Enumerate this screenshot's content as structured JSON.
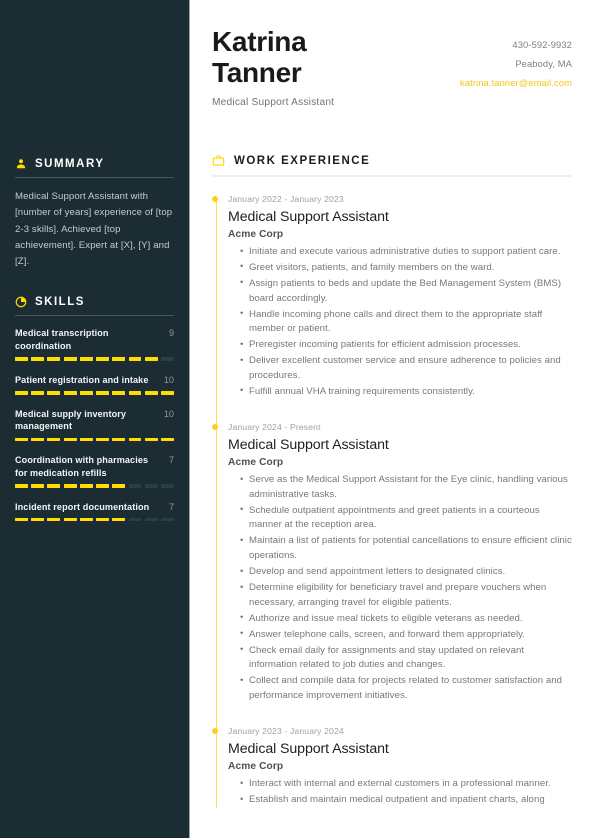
{
  "header": {
    "first_name": "Katrina",
    "last_name": "Tanner",
    "job_title": "Medical Support Assistant",
    "phone": "430-592-9932",
    "location": "Peabody, MA",
    "email": "katrina.tanner@email.com",
    "accent_color": "#ffdd00",
    "email_color": "#f5c518"
  },
  "sidebar": {
    "background_color": "#1b2d33",
    "summary": {
      "icon": "person-icon",
      "title": "SUMMARY",
      "text": "Medical Support Assistant with [number of years] experience of [top 2-3 skills]. Achieved [top achievement]. Expert at [X], [Y] and [Z]."
    },
    "skills": {
      "icon": "pie-chart-icon",
      "title": "SKILLS",
      "max_score": 10,
      "items": [
        {
          "name": "Medical transcription coordination",
          "score": 9
        },
        {
          "name": "Patient registration and intake",
          "score": 10
        },
        {
          "name": "Medical supply inventory management",
          "score": 10
        },
        {
          "name": "Coordination with pharmacies for medication refills",
          "score": 7
        },
        {
          "name": "Incident report documentation",
          "score": 7
        }
      ]
    }
  },
  "work_experience": {
    "icon": "briefcase-icon",
    "title": "WORK EXPERIENCE",
    "entries": [
      {
        "date": "January 2022 - January 2023",
        "role": "Medical Support Assistant",
        "company": "Acme Corp",
        "bullets": [
          "Initiate and execute various administrative duties to support patient care.",
          "Greet visitors, patients, and family members on the ward.",
          "Assign patients to beds and update the Bed Management System (BMS) board accordingly.",
          "Handle incoming phone calls and direct them to the appropriate staff member or patient.",
          "Preregister incoming patients for efficient admission processes.",
          "Deliver excellent customer service and ensure adherence to policies and procedures.",
          "Fulfill annual VHA training requirements consistently."
        ]
      },
      {
        "date": "January 2024 - Present",
        "role": "Medical Support Assistant",
        "company": "Acme Corp",
        "bullets": [
          "Serve as the Medical Support Assistant for the Eye clinic, handling various administrative tasks.",
          "Schedule outpatient appointments and greet patients in a courteous manner at the reception area.",
          "Maintain a list of patients for potential cancellations to ensure efficient clinic operations.",
          "Develop and send appointment letters to designated clinics.",
          "Determine eligibility for beneficiary travel and prepare vouchers when necessary, arranging travel for eligible patients.",
          "Authorize and issue meal tickets to eligible veterans as needed.",
          "Answer telephone calls, screen, and forward them appropriately.",
          "Check email daily for assignments and stay updated on relevant information related to job duties and changes.",
          "Collect and compile data for projects related to customer satisfaction and performance improvement initiatives."
        ]
      },
      {
        "date": "January 2023 - January 2024",
        "role": "Medical Support Assistant",
        "company": "Acme Corp",
        "bullets": [
          "Interact with internal and external customers in a professional manner.",
          "Establish and maintain medical outpatient and inpatient charts, along"
        ]
      }
    ]
  }
}
